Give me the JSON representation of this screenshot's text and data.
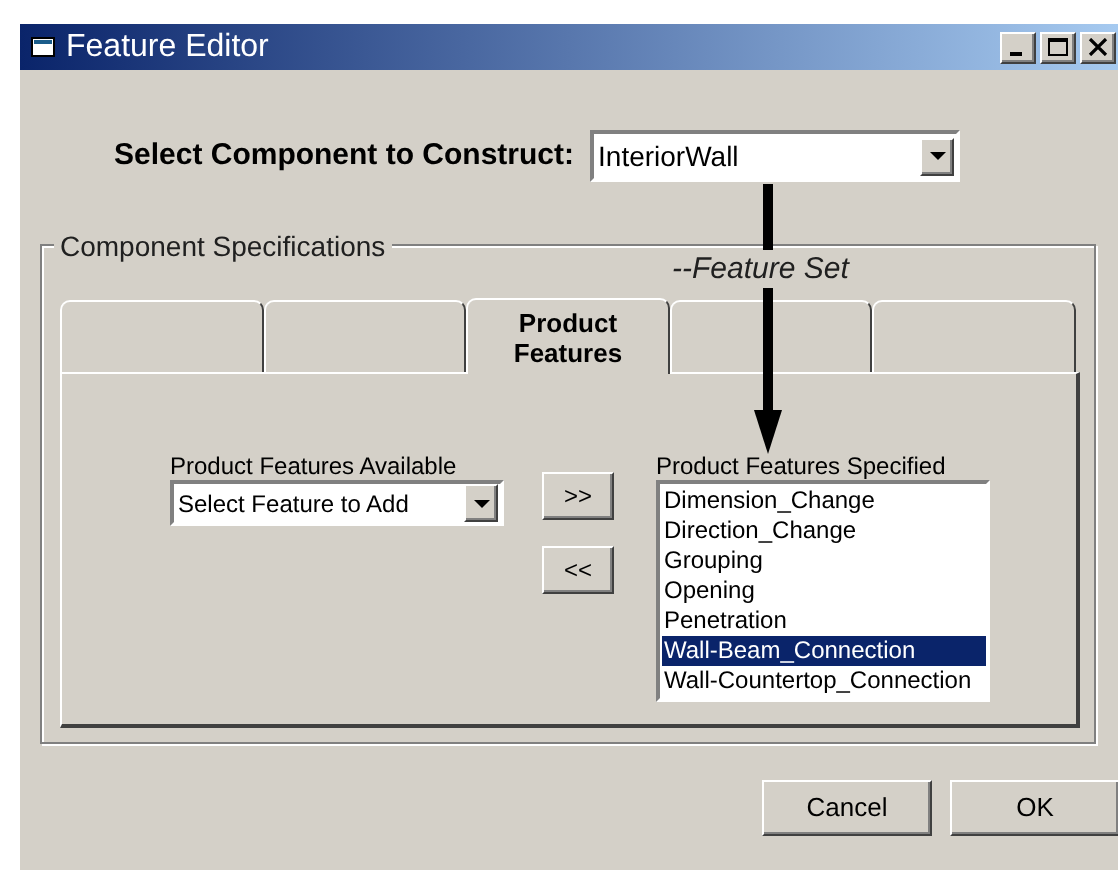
{
  "window": {
    "title": "Feature Editor"
  },
  "component_select": {
    "label": "Select Component to Construct:",
    "value": "InteriorWall"
  },
  "group": {
    "title": "Component Specifications"
  },
  "annotation": {
    "text": "--Feature Set"
  },
  "tabs": [
    {
      "selected": false
    },
    {
      "selected": false
    },
    {
      "label": "Product Features",
      "selected": true
    },
    {
      "selected": false
    },
    {
      "selected": false
    }
  ],
  "available": {
    "label": "Product Features Available",
    "value": "Select Feature to Add"
  },
  "move_buttons": [
    ">>",
    "<<"
  ],
  "specified": {
    "label": "Product Features Specified",
    "items": [
      {
        "text": "Dimension_Change",
        "selected": false
      },
      {
        "text": "Direction_Change",
        "selected": false
      },
      {
        "text": "Grouping",
        "selected": false
      },
      {
        "text": "Opening",
        "selected": false
      },
      {
        "text": "Penetration",
        "selected": false
      },
      {
        "text": "Wall-Beam_Connection",
        "selected": true
      },
      {
        "text": "Wall-Countertop_Connection",
        "selected": false
      }
    ]
  },
  "buttons": [
    "Cancel",
    "OK"
  ]
}
